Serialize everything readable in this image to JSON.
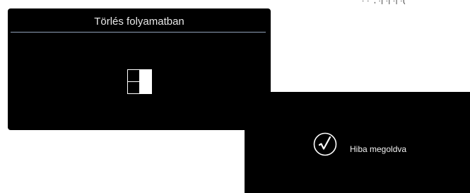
{
  "top_fragment": "· · ’, ·| ·| ·| ·(",
  "delete_dialog": {
    "title": "Törlés folyamatban",
    "icons": {
      "spinner": "grid-spinner-icon"
    }
  },
  "resolved_panel": {
    "message": "Hiba megoldva",
    "icons": {
      "check": "checkmark-circle-icon"
    }
  },
  "colors": {
    "panel_bg": "#000000",
    "divider": "#8fa0b8",
    "text": "#ffffff"
  }
}
